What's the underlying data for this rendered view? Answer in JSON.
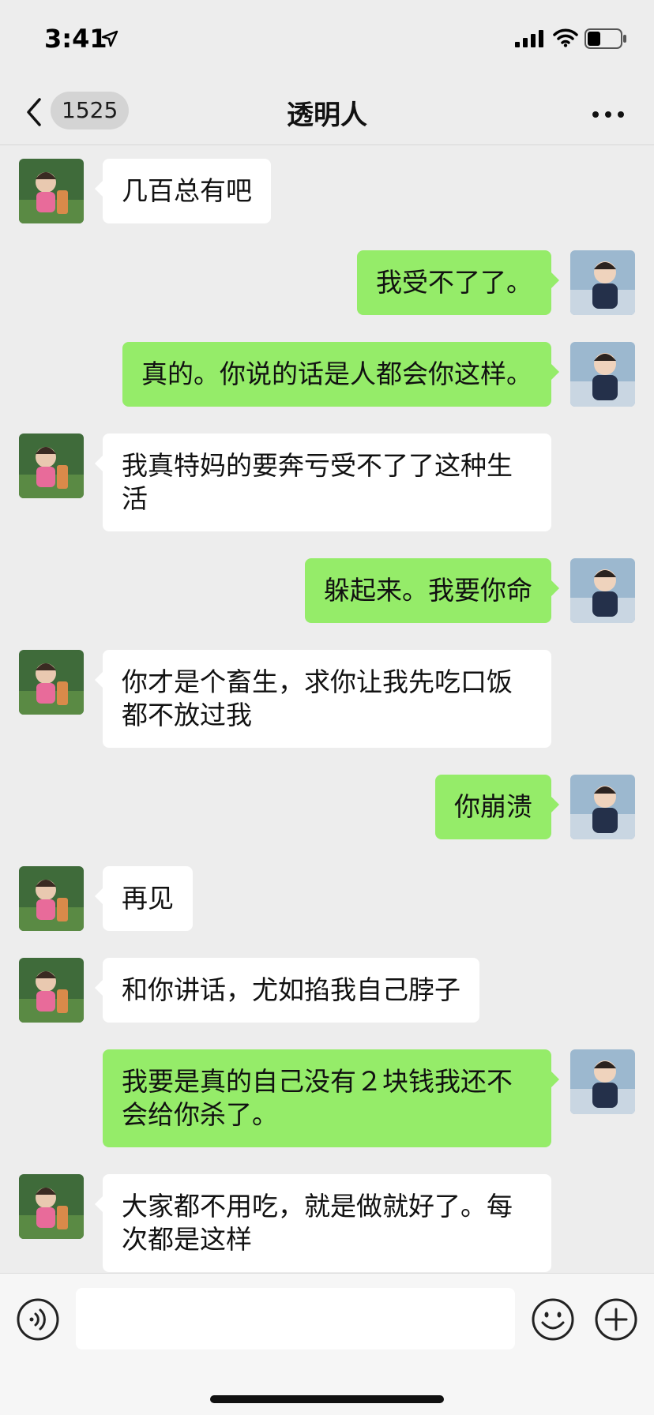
{
  "status_bar": {
    "time": "3:41",
    "icons": [
      "location-arrow-icon",
      "signal-icon",
      "wifi-icon",
      "battery-icon"
    ]
  },
  "nav": {
    "back_icon": "chevron-left-icon",
    "unread_count": "1525",
    "title": "透明人",
    "more_icon": "more-dots-icon"
  },
  "messages": [
    {
      "side": "in",
      "text": "几百总有吧"
    },
    {
      "side": "out",
      "text": "我受不了了。"
    },
    {
      "side": "out",
      "text": "真的。你说的话是人都会你这样。"
    },
    {
      "side": "in",
      "text": "我真特妈的要奔亏受不了了这种生活"
    },
    {
      "side": "out",
      "text": "躲起来。我要你命"
    },
    {
      "side": "in",
      "text": "你才是个畜生，求你让我先吃口饭都不放过我"
    },
    {
      "side": "out",
      "text": "你崩溃"
    },
    {
      "side": "in",
      "text": "再见"
    },
    {
      "side": "in",
      "text": "和你讲话，尤如掐我自己脖子"
    },
    {
      "side": "out",
      "text": "我要是真的自己没有２块钱我还不会给你杀了。"
    },
    {
      "side": "in",
      "text": "大家都不用吃，就是做就好了。每次都是这样"
    }
  ],
  "input_bar": {
    "voice_icon": "voice-icon",
    "text_value": "",
    "emoji_icon": "emoji-icon",
    "plus_icon": "plus-icon"
  },
  "colors": {
    "background": "#ededed",
    "incoming_bubble": "#ffffff",
    "outgoing_bubble": "#95ec69"
  }
}
